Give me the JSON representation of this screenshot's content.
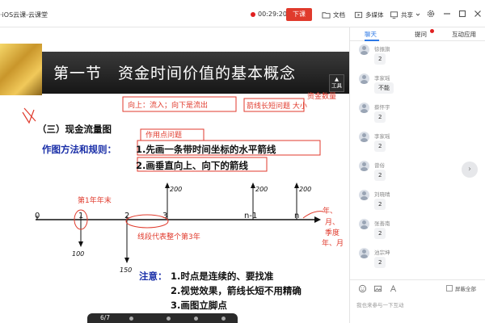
{
  "titlebar": {
    "app_title": "·iOS云课-云课堂",
    "timer": "00:29:20",
    "end_button": "下课",
    "doc_label": "文档",
    "media_label": "多媒体",
    "share_label": "共享"
  },
  "slide": {
    "title": "第一节　资金时间价值的基本概念",
    "tool_label": "工具",
    "section_heading": "（三）现金流量图",
    "rule_label": "作图方法和规则：",
    "rule_1": "1.先画一条带时间坐标的水平箭线",
    "rule_2": "2.画垂直向上、向下的箭线",
    "note_label": "注意：",
    "note_1": "1.时点是连续的、要找准",
    "note_2": "2.视觉效果，箭线长短不用精确",
    "note_3": "3.画图立脚点",
    "timeline_labels": [
      "0",
      "1",
      "2",
      "3",
      "n-1",
      "n"
    ],
    "flow_values": {
      "up_3": "200",
      "up_n1": "200",
      "up_n": "200",
      "down_1": "100",
      "down_2": "150"
    },
    "annotations": {
      "up_inflow": "向上：流入；向下是流出",
      "arrow_length": "箭线长短问题 大小",
      "fund_amount": "资金数量",
      "action_point": "作用点问题",
      "year_end": "第1年年末",
      "segment": "线段代表整个第3年",
      "year_words": [
        "年、",
        "月、",
        "季度",
        "年、月"
      ]
    },
    "page_indicator": "6/7"
  },
  "panel": {
    "tabs": [
      "聊天",
      "提问",
      "互动应用"
    ],
    "messages": [
      {
        "sender": "徐振旗",
        "text": "2"
      },
      {
        "sender": "李家瑶",
        "text": "不能"
      },
      {
        "sender": "蔡怀宇",
        "text": "2"
      },
      {
        "sender": "李家瑶",
        "text": "2"
      },
      {
        "sender": "曾俗",
        "text": "2"
      },
      {
        "sender": "刘晓晴",
        "text": "2"
      },
      {
        "sender": "张善南",
        "text": "2"
      },
      {
        "sender": "池宗坤",
        "text": "2"
      }
    ],
    "ban_all_label": "屏蔽全部",
    "input_placeholder": "我也来参与一下互动"
  },
  "colors": {
    "accent_blue": "#2c78e6",
    "end_red": "#e03a2c",
    "annotation_red": "#e03a2c",
    "slide_blue_text": "#1a2fa8"
  }
}
